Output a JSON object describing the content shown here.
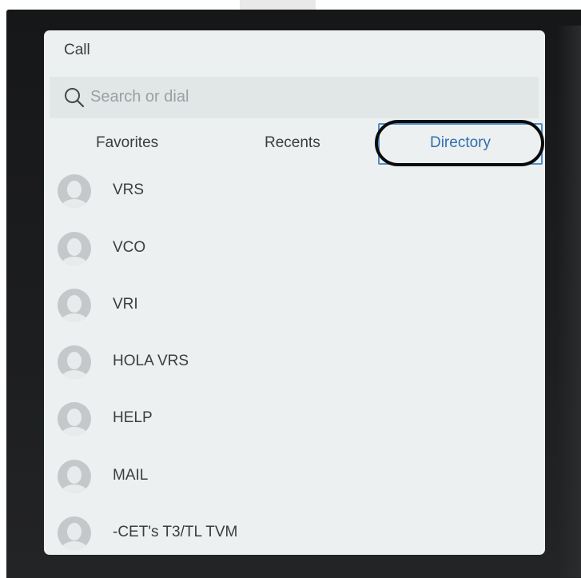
{
  "panel": {
    "title": "Call"
  },
  "search": {
    "placeholder": "Search or dial",
    "icon": "search-icon"
  },
  "tabs": [
    {
      "label": "Favorites",
      "selected": false
    },
    {
      "label": "Recents",
      "selected": false
    },
    {
      "label": "Directory",
      "selected": true
    }
  ],
  "contacts": [
    {
      "name": "VRS"
    },
    {
      "name": "VCO"
    },
    {
      "name": "VRI"
    },
    {
      "name": "HOLA VRS"
    },
    {
      "name": "HELP"
    },
    {
      "name": "MAIL"
    },
    {
      "name": "-CET's T3/TL TVM"
    }
  ],
  "colors": {
    "panel_bg": "#ecf0f0",
    "selected_tab_text": "#2f6fae",
    "selected_tab_border": "#4f8ec7",
    "annotation_circle": "#0b0b0b"
  }
}
